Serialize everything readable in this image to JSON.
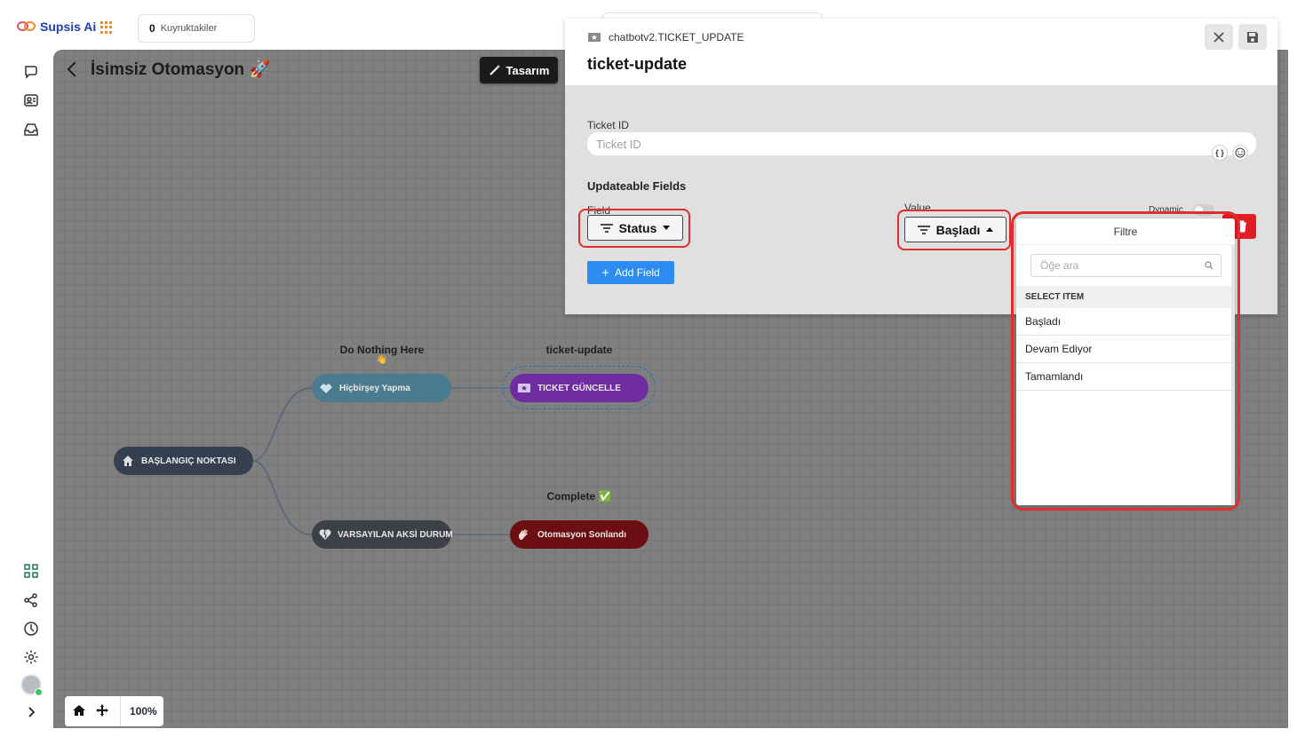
{
  "app": {
    "name": "Supsis Ai",
    "queue_count": "0",
    "queue_label": "Kuyruktakiler"
  },
  "canvas": {
    "title": "İsimsiz Otomasyon 🚀",
    "design_button": "Tasarım",
    "zoom": "100%",
    "nodes": {
      "start": {
        "label": "BAŞLANGIÇ NOKTASI"
      },
      "nothing": {
        "caption": "Do Nothing Here",
        "emoji": "👋",
        "label": "Hiçbirşey Yapma"
      },
      "ticket": {
        "caption": "ticket-update",
        "label": "TICKET GÜNCELLE"
      },
      "default": {
        "label": "VARSAYILAN AKSİ DURUM"
      },
      "end": {
        "caption": "Complete ✅",
        "label": "Otomasyon Sonlandı"
      }
    }
  },
  "panel": {
    "subtitle": "chatbotv2.TICKET_UPDATE",
    "title": "ticket-update",
    "ticket_id_label": "Ticket ID",
    "ticket_id_placeholder": "Ticket ID",
    "ticket_id_value": "",
    "updateable_title": "Updateable Fields",
    "field_label": "Field",
    "field_value": "Status",
    "value_label": "Value",
    "value_value": "Başladı",
    "dynamic_label": "Dynamic",
    "dynamic_on": false,
    "add_field": "Add Field"
  },
  "dropdown": {
    "title": "Filtre",
    "search_placeholder": "Öğe ara",
    "section": "SELECT ITEM",
    "items": [
      "Başladı",
      "Devam Ediyor",
      "Tamamlandı"
    ]
  },
  "colors": {
    "accent_blue": "#2d8cf0",
    "danger": "#e01c24",
    "highlight": "#e02e2e",
    "ticket_node": "#6e2ea1",
    "end_node": "#6b0f13"
  }
}
